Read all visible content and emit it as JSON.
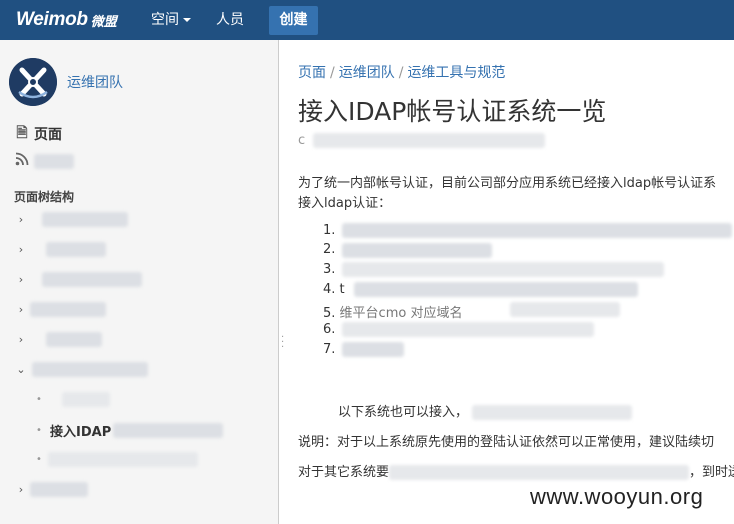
{
  "topbar": {
    "logo_text": "Weimob",
    "logo_cn": "微盟",
    "nav": [
      {
        "label": "空间",
        "has_dropdown": true
      },
      {
        "label": "人员",
        "has_dropdown": false
      }
    ],
    "create_label": "创建",
    "brand_color": "#205081",
    "accent_color": "#3572b0"
  },
  "sidebar": {
    "space_name": "运维团队",
    "links": [
      {
        "label": "页面",
        "icon": "pages-icon"
      },
      {
        "label": "",
        "icon": "rss-icon"
      }
    ],
    "tree_heading": "页面树结构",
    "current_page_label": "接入IDAP"
  },
  "main": {
    "breadcrumb": [
      "页面",
      "运维团队",
      "运维工具与规范"
    ],
    "title": "接入IDAP帐号认证系统一览",
    "byline_prefix": "c",
    "intro_line1": "为了统一内部帐号认证，目前公司部分应用系统已经接入ldap帐号认证系",
    "intro_line2": "接入ldap认证：",
    "list_numbers": [
      "1.",
      "2.",
      "3.",
      "4.",
      "5.",
      "6.",
      "7."
    ],
    "list_fragments": {
      "item4_prefix": "t",
      "item5_text": "维平台cmo    对应域名"
    },
    "also_text": "以下系统也可以接入，",
    "note_line": "说明：对于以上系统原先使用的登陆认证依然可以正常使用，建议陆续切",
    "other_prefix": "对于其它系统要",
    "other_suffix": "，到时送"
  },
  "watermark": "www.wooyun.org"
}
